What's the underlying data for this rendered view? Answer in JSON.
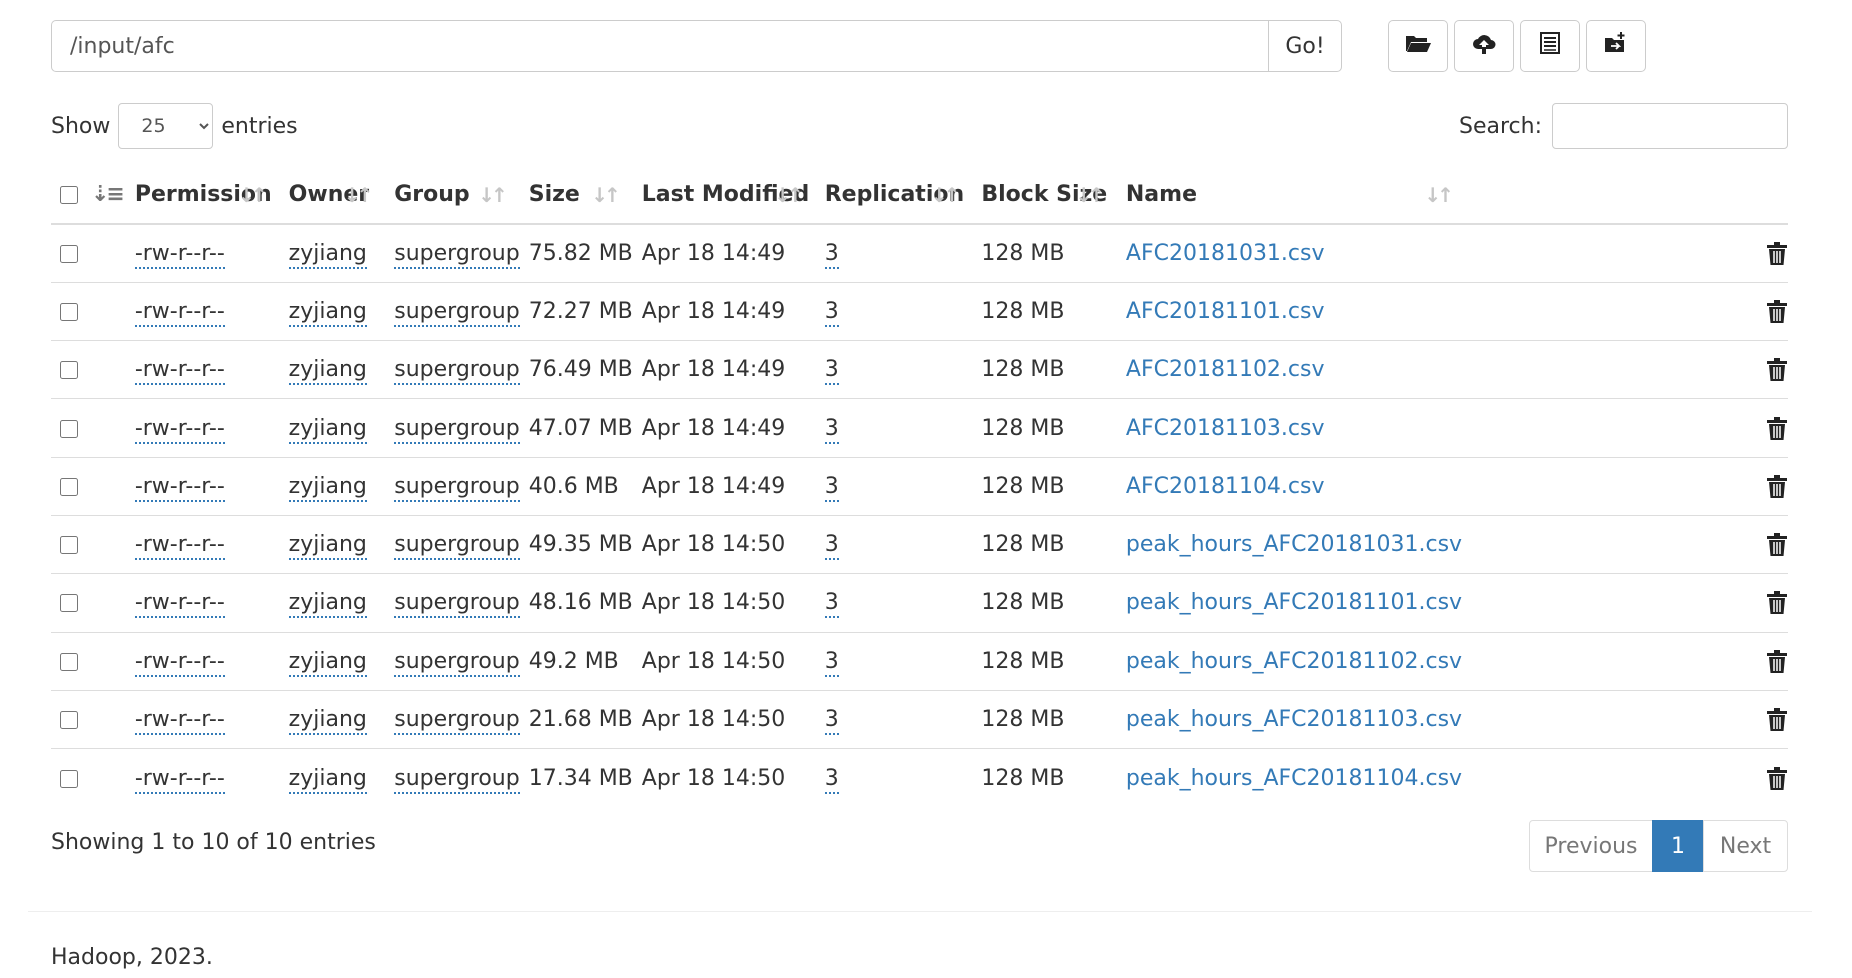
{
  "pathbar": {
    "value": "/input/afc",
    "go_label": "Go!"
  },
  "toolbar": {
    "icons": [
      "folder-open-icon",
      "cloud-upload-icon",
      "list-icon",
      "new-folder-icon"
    ]
  },
  "length": {
    "show_label": "Show",
    "selected": "25",
    "entries_label": "entries"
  },
  "search": {
    "label": "Search:",
    "value": ""
  },
  "table": {
    "headers": [
      "Permission",
      "Owner",
      "Group",
      "Size",
      "Last Modified",
      "Replication",
      "Block Size",
      "Name"
    ],
    "rows": [
      {
        "permission": "-rw-r--r--",
        "owner": "zyjiang",
        "group": "supergroup",
        "size": "75.82 MB",
        "modified": "Apr 18 14:49",
        "replication": "3",
        "block_size": "128 MB",
        "name": "AFC20181031.csv"
      },
      {
        "permission": "-rw-r--r--",
        "owner": "zyjiang",
        "group": "supergroup",
        "size": "72.27 MB",
        "modified": "Apr 18 14:49",
        "replication": "3",
        "block_size": "128 MB",
        "name": "AFC20181101.csv"
      },
      {
        "permission": "-rw-r--r--",
        "owner": "zyjiang",
        "group": "supergroup",
        "size": "76.49 MB",
        "modified": "Apr 18 14:49",
        "replication": "3",
        "block_size": "128 MB",
        "name": "AFC20181102.csv"
      },
      {
        "permission": "-rw-r--r--",
        "owner": "zyjiang",
        "group": "supergroup",
        "size": "47.07 MB",
        "modified": "Apr 18 14:49",
        "replication": "3",
        "block_size": "128 MB",
        "name": "AFC20181103.csv"
      },
      {
        "permission": "-rw-r--r--",
        "owner": "zyjiang",
        "group": "supergroup",
        "size": "40.6 MB",
        "modified": "Apr 18 14:49",
        "replication": "3",
        "block_size": "128 MB",
        "name": "AFC20181104.csv"
      },
      {
        "permission": "-rw-r--r--",
        "owner": "zyjiang",
        "group": "supergroup",
        "size": "49.35 MB",
        "modified": "Apr 18 14:50",
        "replication": "3",
        "block_size": "128 MB",
        "name": "peak_hours_AFC20181031.csv"
      },
      {
        "permission": "-rw-r--r--",
        "owner": "zyjiang",
        "group": "supergroup",
        "size": "48.16 MB",
        "modified": "Apr 18 14:50",
        "replication": "3",
        "block_size": "128 MB",
        "name": "peak_hours_AFC20181101.csv"
      },
      {
        "permission": "-rw-r--r--",
        "owner": "zyjiang",
        "group": "supergroup",
        "size": "49.2 MB",
        "modified": "Apr 18 14:50",
        "replication": "3",
        "block_size": "128 MB",
        "name": "peak_hours_AFC20181102.csv"
      },
      {
        "permission": "-rw-r--r--",
        "owner": "zyjiang",
        "group": "supergroup",
        "size": "21.68 MB",
        "modified": "Apr 18 14:50",
        "replication": "3",
        "block_size": "128 MB",
        "name": "peak_hours_AFC20181103.csv"
      },
      {
        "permission": "-rw-r--r--",
        "owner": "zyjiang",
        "group": "supergroup",
        "size": "17.34 MB",
        "modified": "Apr 18 14:50",
        "replication": "3",
        "block_size": "128 MB",
        "name": "peak_hours_AFC20181104.csv"
      }
    ]
  },
  "info": "Showing 1 to 10 of 10 entries",
  "pagination": {
    "previous": "Previous",
    "current": "1",
    "next": "Next"
  },
  "footer": "Hadoop, 2023.",
  "colors": {
    "link": "#337ab7",
    "border": "#dddddd",
    "active_page": "#337ab7"
  }
}
